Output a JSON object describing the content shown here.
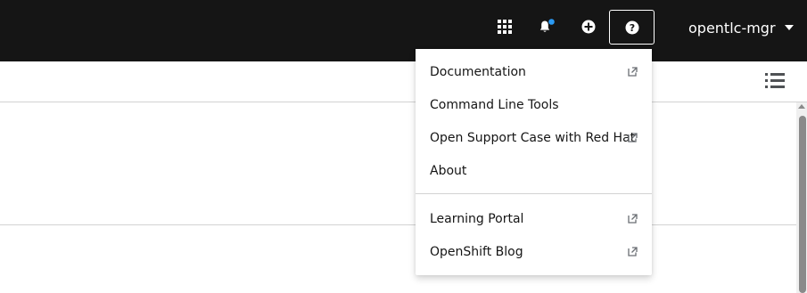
{
  "colors": {
    "masthead": "#151515",
    "notification_dot": "#2b9af3",
    "menu_text": "#151515",
    "external_icon": "#6a6e73",
    "divider": "#d2d2d2"
  },
  "masthead": {
    "icons": [
      "app-launcher-icon",
      "notifications-bell-icon",
      "quick-create-icon",
      "help-icon"
    ],
    "user_name": "opentlc-mgr"
  },
  "help_menu": {
    "group1": [
      {
        "label": "Documentation",
        "external": true
      },
      {
        "label": "Command Line Tools",
        "external": false
      },
      {
        "label": "Open Support Case with Red Hat",
        "external": true
      },
      {
        "label": "About",
        "external": false
      }
    ],
    "group2": [
      {
        "label": "Learning Portal",
        "external": true
      },
      {
        "label": "OpenShift Blog",
        "external": true
      }
    ]
  },
  "toolbar": {
    "view_toggle_icon": "list-view-icon"
  }
}
